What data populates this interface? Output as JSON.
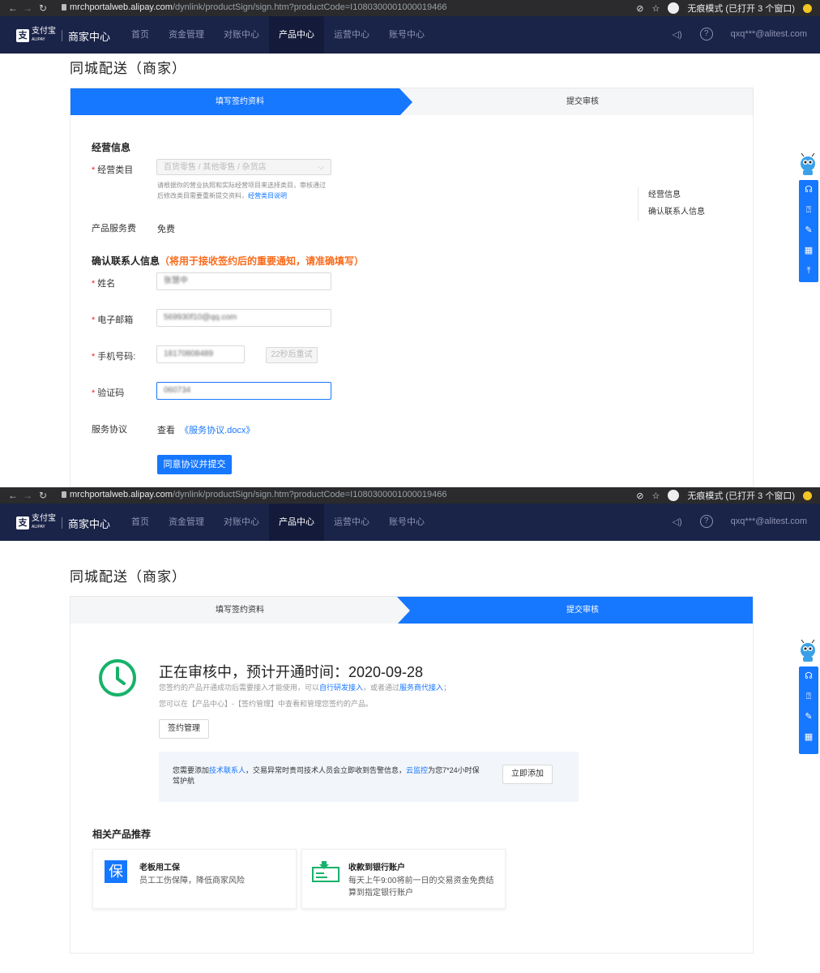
{
  "browser": {
    "url_host": "mrchportalweb.alipay.com",
    "url_path": "/dynlink/productSign/sign.htm?productCode=I1080300001000019466",
    "incognito_text": "无痕模式 (已打开 3 个窗口)"
  },
  "nav": {
    "logo_text": "支付宝",
    "logo_sub": "ALIPAY",
    "title": "商家中心",
    "items": [
      "首页",
      "资金管理",
      "对账中心",
      "产品中心",
      "运营中心",
      "账号中心"
    ],
    "active": "产品中心",
    "user": "qxq***@alitest.com"
  },
  "page_title": "同城配送（商家）",
  "steps": [
    "填写签约资料",
    "提交审核"
  ],
  "form": {
    "biz_section": "经营信息",
    "category_label": "经营类目",
    "category_value": "百货零售 / 其他零售 / 杂货店",
    "category_hint": "请根据你的营业执照和实际经营项目来选择类目，审核通过后修改类目需要重新提交资料，",
    "category_hint_link": "经营类目说明",
    "fee_label": "产品服务费",
    "fee_value": "免费",
    "contact_section": "确认联系人信息",
    "contact_note": "（将用于接收签约后的重要通知，请准确填写）",
    "name_label": "姓名",
    "name_value": "张慧中",
    "email_label": "电子邮箱",
    "email_value": "569930f10@qq.com",
    "phone_label": "手机号码:",
    "phone_value": "18170808489",
    "resend": "22秒后重试",
    "code_label": "验证码",
    "code_value": "060734",
    "agreement_label": "服务协议",
    "agreement_view": "查看",
    "agreement_link": "《服务协议.docx》",
    "submit": "同意协议并提交"
  },
  "toc": [
    "经营信息",
    "确认联系人信息"
  ],
  "review": {
    "title": "正在审核中，预计开通时间：2020-09-28",
    "line1_pre": "您签约的产品开通成功后需要接入才能使用，可以",
    "line1_link1": "自行研发接入",
    "line1_mid": "，或者通过",
    "line1_link2": "服务商代接入",
    "line1_end": "；",
    "line2": "您可以在【产品中心】-【签约管理】中查看和管理您签约的产品。",
    "manage_btn": "签约管理",
    "notice_pre": "您需要添加",
    "notice_link1": "技术联系人",
    "notice_mid": "，交易异常时贵司技术人员会立即收到告警信息，",
    "notice_link2": "云监控",
    "notice_end": "为您7*24小时保驾护航",
    "add_btn": "立即添加"
  },
  "recommend": {
    "title": "相关产品推荐",
    "items": [
      {
        "icon_char": "保",
        "name": "老板用工保",
        "desc": "员工工伤保障，降低商家风险"
      },
      {
        "icon_char": "",
        "name": "收款到银行账户",
        "desc": "每天上午9:00将前一日的交易资金免费结算到指定银行账户"
      }
    ]
  },
  "colors": {
    "primary": "#1677ff",
    "nav_bg": "#1a2348",
    "success": "#17b26a",
    "warning": "#fa6b1b"
  }
}
